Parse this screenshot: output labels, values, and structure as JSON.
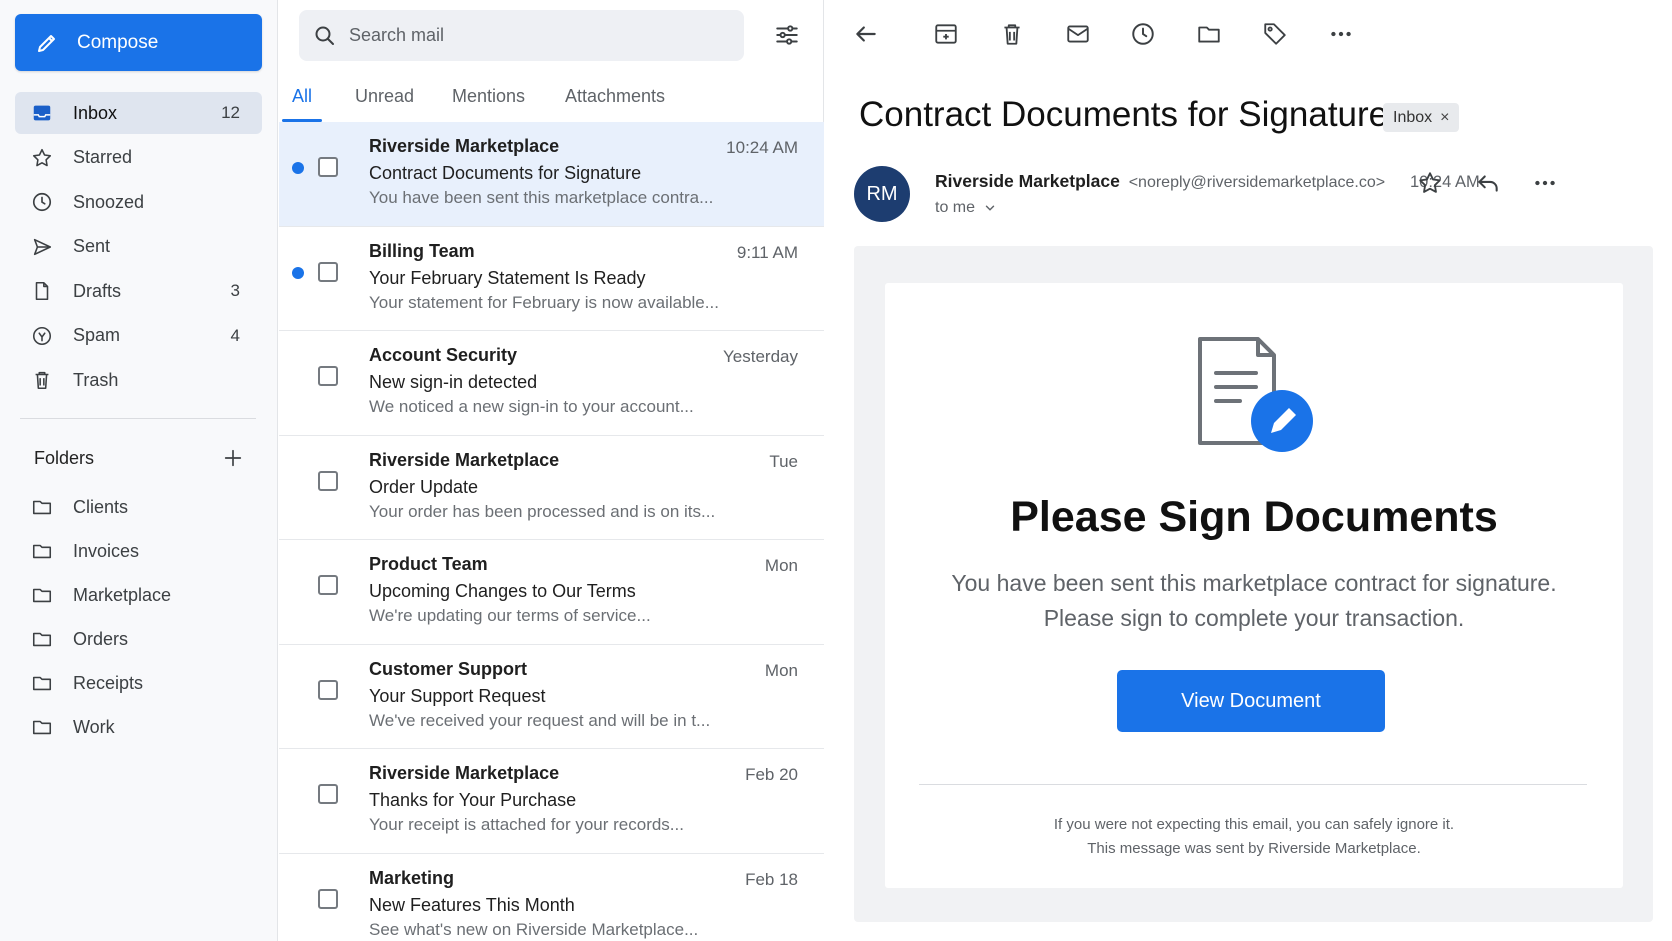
{
  "sidebar": {
    "compose_label": "Compose",
    "nav": [
      {
        "label": "Inbox",
        "count": "12",
        "icon": "inbox-icon"
      },
      {
        "label": "Starred",
        "count": "",
        "icon": "star-icon"
      },
      {
        "label": "Snoozed",
        "count": "",
        "icon": "clock-icon"
      },
      {
        "label": "Sent",
        "count": "",
        "icon": "send-icon"
      },
      {
        "label": "Drafts",
        "count": "3",
        "icon": "draft-icon"
      },
      {
        "label": "Spam",
        "count": "4",
        "icon": "spam-icon"
      },
      {
        "label": "Trash",
        "count": "",
        "icon": "trash-icon"
      }
    ],
    "folders_label": "Folders",
    "folders": [
      "Clients",
      "Invoices",
      "Marketplace",
      "Orders",
      "Receipts",
      "Work"
    ]
  },
  "list": {
    "search_placeholder": "Search mail",
    "tabs": [
      "All",
      "Unread",
      "Mentions",
      "Attachments"
    ],
    "emails": [
      {
        "sender": "Riverside Marketplace",
        "time": "10:24 AM",
        "subject": "Contract Documents for Signature",
        "preview": "You have been sent this marketplace contra...",
        "unread": true,
        "selected": true
      },
      {
        "sender": "Billing Team",
        "time": "9:11 AM",
        "subject": "Your February Statement Is Ready",
        "preview": "Your statement for February is now available...",
        "unread": true,
        "selected": false
      },
      {
        "sender": "Account Security",
        "time": "Yesterday",
        "subject": "New sign-in detected",
        "preview": "We noticed a new sign-in to your account...",
        "unread": false,
        "selected": false
      },
      {
        "sender": "Riverside Marketplace",
        "time": "Tue",
        "subject": "Order Update",
        "preview": "Your order has been processed and is on its...",
        "unread": false,
        "selected": false
      },
      {
        "sender": "Product Team",
        "time": "Mon",
        "subject": "Upcoming Changes to Our Terms",
        "preview": "We're updating our terms of service...",
        "unread": false,
        "selected": false
      },
      {
        "sender": "Customer Support",
        "time": "Mon",
        "subject": "Your Support Request",
        "preview": "We've received your request and will be in t...",
        "unread": false,
        "selected": false
      },
      {
        "sender": "Riverside Marketplace",
        "time": "Feb 20",
        "subject": "Thanks for Your Purchase",
        "preview": "Your receipt is attached for your records...",
        "unread": false,
        "selected": false
      },
      {
        "sender": "Marketing",
        "time": "Feb 18",
        "subject": "New Features This Month",
        "preview": "See what's new on Riverside Marketplace...",
        "unread": false,
        "selected": false
      }
    ]
  },
  "message": {
    "subject": "Contract Documents for Signature",
    "label_chip": "Inbox",
    "chip_close": "×",
    "avatar_initials": "RM",
    "sender_name": "Riverside Marketplace",
    "sender_email": "<noreply@riversidemarketplace.co>",
    "to": "to me",
    "time": "10:24 AM",
    "body": {
      "title": "Please Sign Documents",
      "line1": "You have been sent this marketplace contract for signature.",
      "line2": "Please sign to complete your transaction.",
      "button": "View Document",
      "footer1": "If you were not expecting this email, you can safely ignore it.",
      "footer2": "This message was sent by Riverside Marketplace."
    }
  },
  "colors": {
    "accent": "#1a73e8",
    "avatar_bg": "#1d3d70",
    "selected_row": "#e8f0fc",
    "active_nav": "#dfe5ef"
  }
}
